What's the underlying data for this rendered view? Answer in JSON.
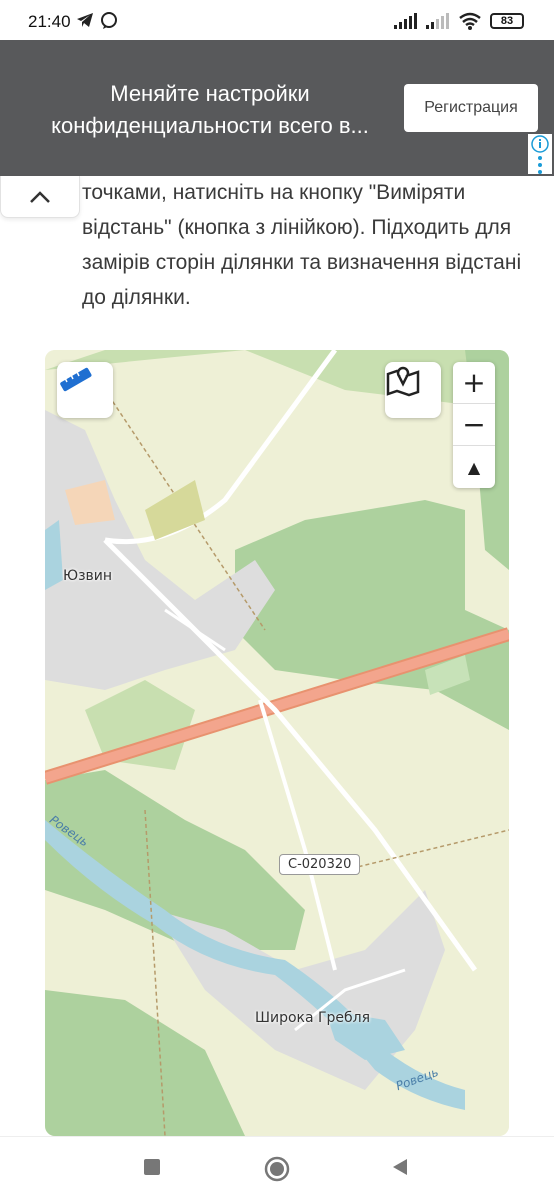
{
  "status_bar": {
    "time": "21:40",
    "battery": "83",
    "icons": [
      "telegram-icon",
      "viber-icon",
      "signal-icon",
      "signal-icon",
      "wifi-icon",
      "battery-icon"
    ]
  },
  "consent_banner": {
    "text": "Меняйте настройки конфиденциальности всего в...",
    "register_label": "Регистрация"
  },
  "article": {
    "clipped_line": "точками, натисніть на кнопку \"Виміряти",
    "paragraph": "відстань\" (кнопка з лінійкою). Підходить для замірів сторін ділянки та визначення відстані до ділянки."
  },
  "map": {
    "zoom_in": "+",
    "zoom_out": "−",
    "compass": "▲",
    "labels": {
      "village_top": "Юзвин",
      "village_bottom": "Широка Гребля",
      "road": "C-020320",
      "river_left": "Ровець",
      "river_right": "Ровець"
    },
    "colors": {
      "forest": "#add19e",
      "field": "#eef0d6",
      "settlement": "#dddddd",
      "water": "#aad3df",
      "highway": "#f3a58d"
    }
  },
  "navbar": {
    "icons": [
      "recent-apps-icon",
      "home-icon",
      "back-icon"
    ]
  }
}
